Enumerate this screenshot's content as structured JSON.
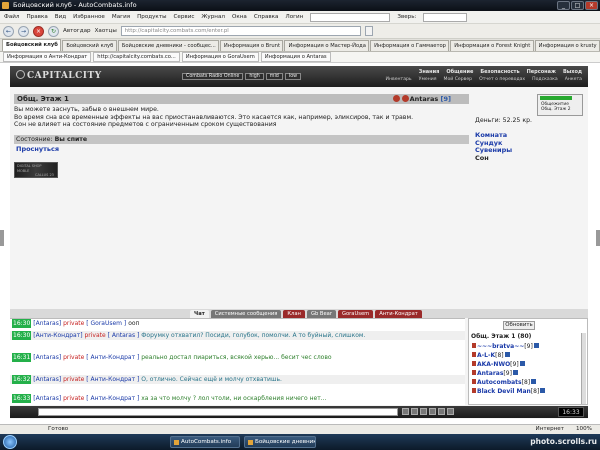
{
  "window": {
    "title": "Бойцовский клуб - AutoCombats.info",
    "controls": [
      "_",
      "□",
      "×"
    ]
  },
  "menu": {
    "items": [
      "Файл",
      "Правка",
      "Вид",
      "Избранное",
      "Магия",
      "Продукты",
      "Сервис",
      "Журнал",
      "Окна",
      "Справка"
    ],
    "login_label": "Логин",
    "password_label": "Зверь:"
  },
  "nav": {
    "back": "←",
    "forward": "→",
    "stop": "×",
    "refresh": "↻",
    "autoload": "Автогдар",
    "favorites": "Хаотцы",
    "address": "http://capitalcity.combats.com/enter.pl"
  },
  "tabs": [
    "Бойцовский клуб",
    "Бойцовский клуб",
    "Бойцовские дневники - сообщес...",
    "Информация о Brunt",
    "Информация о Мастер-Йода",
    "Информация о Гаммаетор",
    "Информация о Forest Knight",
    "Информация о krusty"
  ],
  "subtabs": [
    "Информация о Анти-Кондрат",
    "http://capitalcity.combats.co...",
    "Информация о GoraUsem",
    "Информация о Antaras"
  ],
  "game": {
    "logo": "CAPITALCITY",
    "radio": [
      "Combats Radio Online",
      "high",
      "mid",
      "low"
    ],
    "menu_top": [
      "Знания",
      "Общение",
      "Безопасность",
      "Персонаж",
      "Выход"
    ],
    "menu_bottom": [
      "Инвентарь",
      "Умения",
      "Мой Сервер",
      "Отчет о переводах",
      "Подсказка",
      "Анкета"
    ],
    "location_title": "Общ. Этаж 1",
    "player_name": "Antaras",
    "player_level": "[9]",
    "messages": [
      "Вы можете заснуть, забыв о внешнем мире.",
      "Во время сна все временные эффекты на вас приостанавливаются. Это касается как, например, эликсиров, так и травм.",
      "Сон не влияет на состояние предметов с ограниченным сроком существования"
    ],
    "status_label": "Состояние:",
    "status_value": "Вы спите",
    "wake_link": "Проснуться",
    "money": "Деньги: 52.25 кр.",
    "side_links": [
      "Комната",
      "Сундук",
      "Сувениры",
      "Сон"
    ],
    "widget_lines": [
      "Общежитие",
      "Общ. Этаж 2"
    ],
    "thumb_lines": [
      "DIGITAL SHOP",
      "MOBLE",
      "CALLUS 23"
    ]
  },
  "chat": {
    "tabs": [
      "Чат",
      "Системные сообщения",
      "Клан",
      "Gb Bear",
      "GoraUsem",
      "Анти-Кондрат"
    ],
    "lines": [
      {
        "time": "16:30",
        "from": "[Antaras]",
        "priv": "private",
        "to": "[ GoraUsem ]",
        "msg": "ооп",
        "tone": "plain"
      },
      {
        "time": "16:30",
        "from": "[Анти-Кондрат]",
        "priv": "private",
        "to": "[ Antaras ]",
        "msg": "Форумку отхватил? Посиди, голубок, помолчи. А то буйный, слишком.",
        "tone": "bluegreen"
      },
      {
        "time": "16:31",
        "from": "[Antaras]",
        "priv": "private",
        "to": "[ Анти-Кондрат ]",
        "msg": "реально достал пиариться, всякой херью... бесит чес слово",
        "tone": "green"
      },
      {
        "time": "16:32",
        "from": "[Antaras]",
        "priv": "private",
        "to": "[ Анти-Кондрат ]",
        "msg": "О, отлично. Сейчас ещё и молчу отхватишь.",
        "tone": "bluegreen"
      },
      {
        "time": "16:33",
        "from": "[Antaras]",
        "priv": "private",
        "to": "[ Анти-Кондрат ]",
        "msg": "ха за что молчу ? лол чтоли, ни оскарбления ничего нет...",
        "tone": "green"
      }
    ],
    "refresh_label": "Обновить",
    "online_title": "Общ. Этаж 1 (80)",
    "online": [
      {
        "name": "~~~bratva~~",
        "level": "[9]"
      },
      {
        "name": "A-L-K",
        "level": "[8]"
      },
      {
        "name": "AKA-NWO",
        "level": "[9]"
      },
      {
        "name": "Antaras",
        "level": "[9]"
      },
      {
        "name": "Autocombats",
        "level": "[8]"
      },
      {
        "name": "Black Devil Man",
        "level": "[8]"
      }
    ],
    "clock": "16:33"
  },
  "status": {
    "ready": "Готово",
    "zone": "Интернет",
    "zoom": "100%"
  },
  "taskbar": {
    "items": [
      "AutoCombats.info",
      "Бойцовские дневник..."
    ],
    "watermark": "photo.scrolls.ru"
  }
}
